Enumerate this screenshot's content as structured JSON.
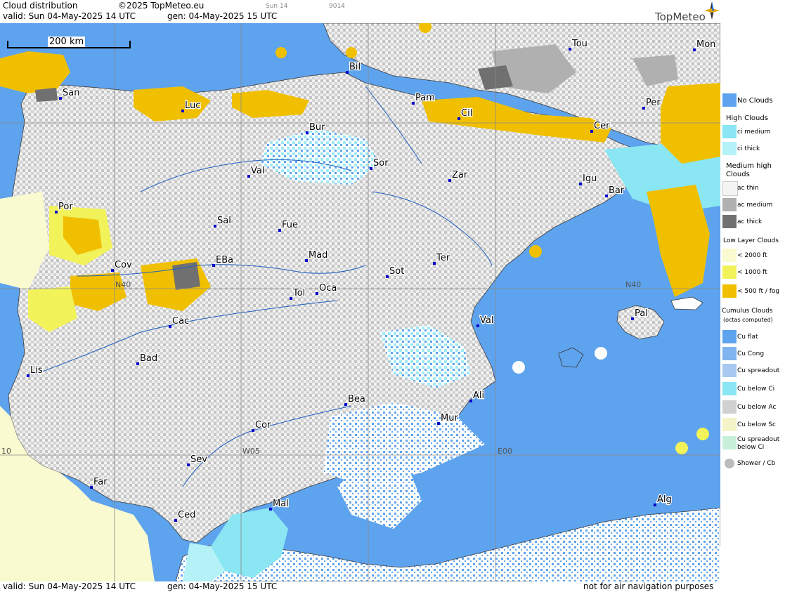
{
  "header": {
    "title": "Cloud distribution",
    "copyright": "©2025 TopMeteo.eu",
    "day_code": "Sun 14",
    "code": "9014",
    "valid": "valid:  Sun  04-May-2025  14 UTC",
    "gen": "gen: 04-May-2025 15 UTC",
    "brand": "TopMeteo"
  },
  "footer": {
    "valid": "valid:  Sun  04-May-2025  14 UTC",
    "gen": "gen: 04-May-2025 15 UTC",
    "disclaimer": "not for air navigation purposes"
  },
  "map": {
    "scale_label": "200 km",
    "grid_labels": [
      "N40",
      "N40",
      "W05",
      "E00",
      "10"
    ],
    "cities": [
      "Mon",
      "Tou",
      "Bil",
      "San",
      "Pam",
      "Luc",
      "Cil",
      "Per",
      "Cer",
      "Bur",
      "Sor",
      "Zar",
      "Igu",
      "Bar",
      "Val",
      "Por",
      "Sal",
      "Fue",
      "Mad",
      "Cov",
      "EBa",
      "Ter",
      "Sot",
      "Tol",
      "Oca",
      "Pal",
      "Val",
      "Cac",
      "Lis",
      "Bad",
      "Bea",
      "Ali",
      "Mur",
      "Cor",
      "Sev",
      "Far",
      "Mal",
      "Alg",
      "Ced"
    ],
    "colors": {
      "sea_no_clouds": "#5ea3ee",
      "ci_medium": "#8ae6f2",
      "ci_thick": "#b4f2f8",
      "ac_thin": "#f4f4f4",
      "ac_medium": "#b0b0b0",
      "ac_thick": "#707070",
      "low_2000": "#fafad0",
      "low_1000": "#f2f25a",
      "low_500": "#f0c000",
      "cu_flat": "#5ea3ee",
      "cu_below_ac": "#c8c8c8",
      "land": "#dcdcdc"
    }
  },
  "legend": {
    "no_clouds": "No Clouds",
    "high_head": "High Clouds",
    "ci_medium": "ci medium",
    "ci_thick": "ci thick",
    "medium_head1": "Medium high",
    "medium_head2": "Clouds",
    "ac_thin": "ac thin",
    "ac_medium": "ac medium",
    "ac_thick": "ac thick",
    "low_head": "Low Layer Clouds",
    "low_2000": "< 2000 ft",
    "low_1000": "< 1000 ft",
    "low_500": "< 500 ft / fog",
    "cu_head1": "Cumulus Clouds",
    "cu_head2": "(octas computed)",
    "cu_flat": "Cu flat",
    "cu_cong": "Cu Cong",
    "cu_spreadout": "Cu spreadout",
    "cu_below_ci": "Cu below Ci",
    "cu_below_ac": "Cu below Ac",
    "cu_below_sc": "Cu below Sc",
    "cu_spreadout_ci1": "Cu spreadout",
    "cu_spreadout_ci2": "below Ci",
    "shower": "Shower / Cb"
  }
}
